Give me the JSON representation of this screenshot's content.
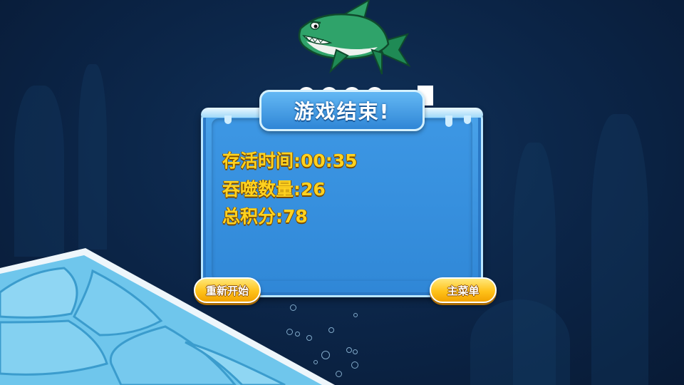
{
  "dialog": {
    "title": "游戏结束!",
    "stats": [
      {
        "label": "存活时间:",
        "value": "00:35"
      },
      {
        "label": "吞噬数量:",
        "value": "26"
      },
      {
        "label": "总积分:",
        "value": "78"
      }
    ]
  },
  "buttons": {
    "restart": "重新开始",
    "main_menu": "主菜单"
  },
  "colors": {
    "background": "#0b2446",
    "panel": "#3189d8",
    "stat_text": "#ffd21f",
    "button": "#ffc21a",
    "shark": "#2fa36a"
  },
  "icons": {
    "player": "green-shark-icon",
    "environment": "ice-shelf"
  }
}
